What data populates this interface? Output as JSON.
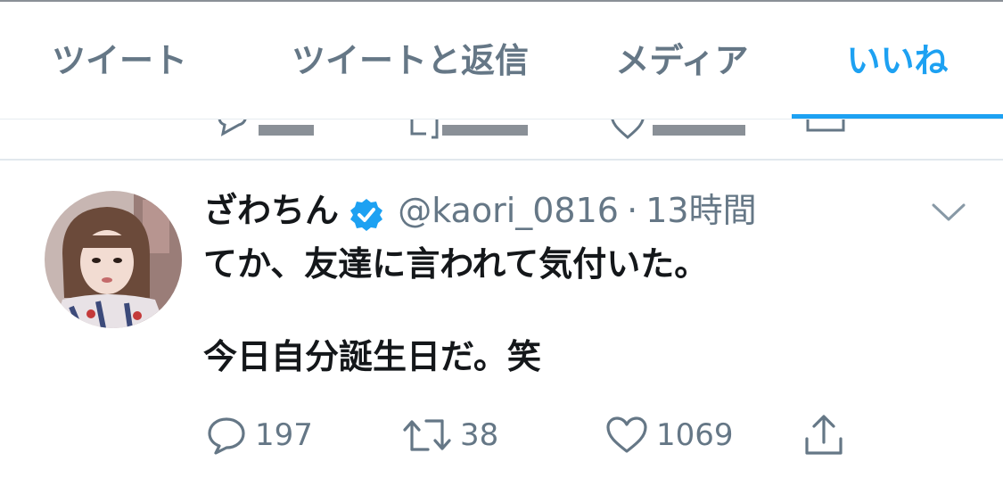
{
  "tabs": [
    {
      "label": "ツイート"
    },
    {
      "label": "ツイートと返信"
    },
    {
      "label": "メディア"
    },
    {
      "label": "いいね"
    }
  ],
  "active_tab_index": 3,
  "colors": {
    "accent": "#1da1f2",
    "secondary_text": "#657786",
    "primary_text": "#14171a"
  },
  "tweet": {
    "author_name": "ざわちん",
    "verified": true,
    "handle": "@kaori_0816",
    "separator": "·",
    "time": "13時間",
    "text_lines": [
      "てか、友達に言われて気付いた。",
      "",
      "今日自分誕生日だ。笑"
    ],
    "actions": {
      "reply_count": "197",
      "retweet_count": "38",
      "like_count": "1069"
    }
  },
  "icons": [
    "reply-icon",
    "retweet-icon",
    "like-icon",
    "share-icon",
    "verified-badge-icon",
    "chevron-down-icon",
    "avatar-image"
  ]
}
